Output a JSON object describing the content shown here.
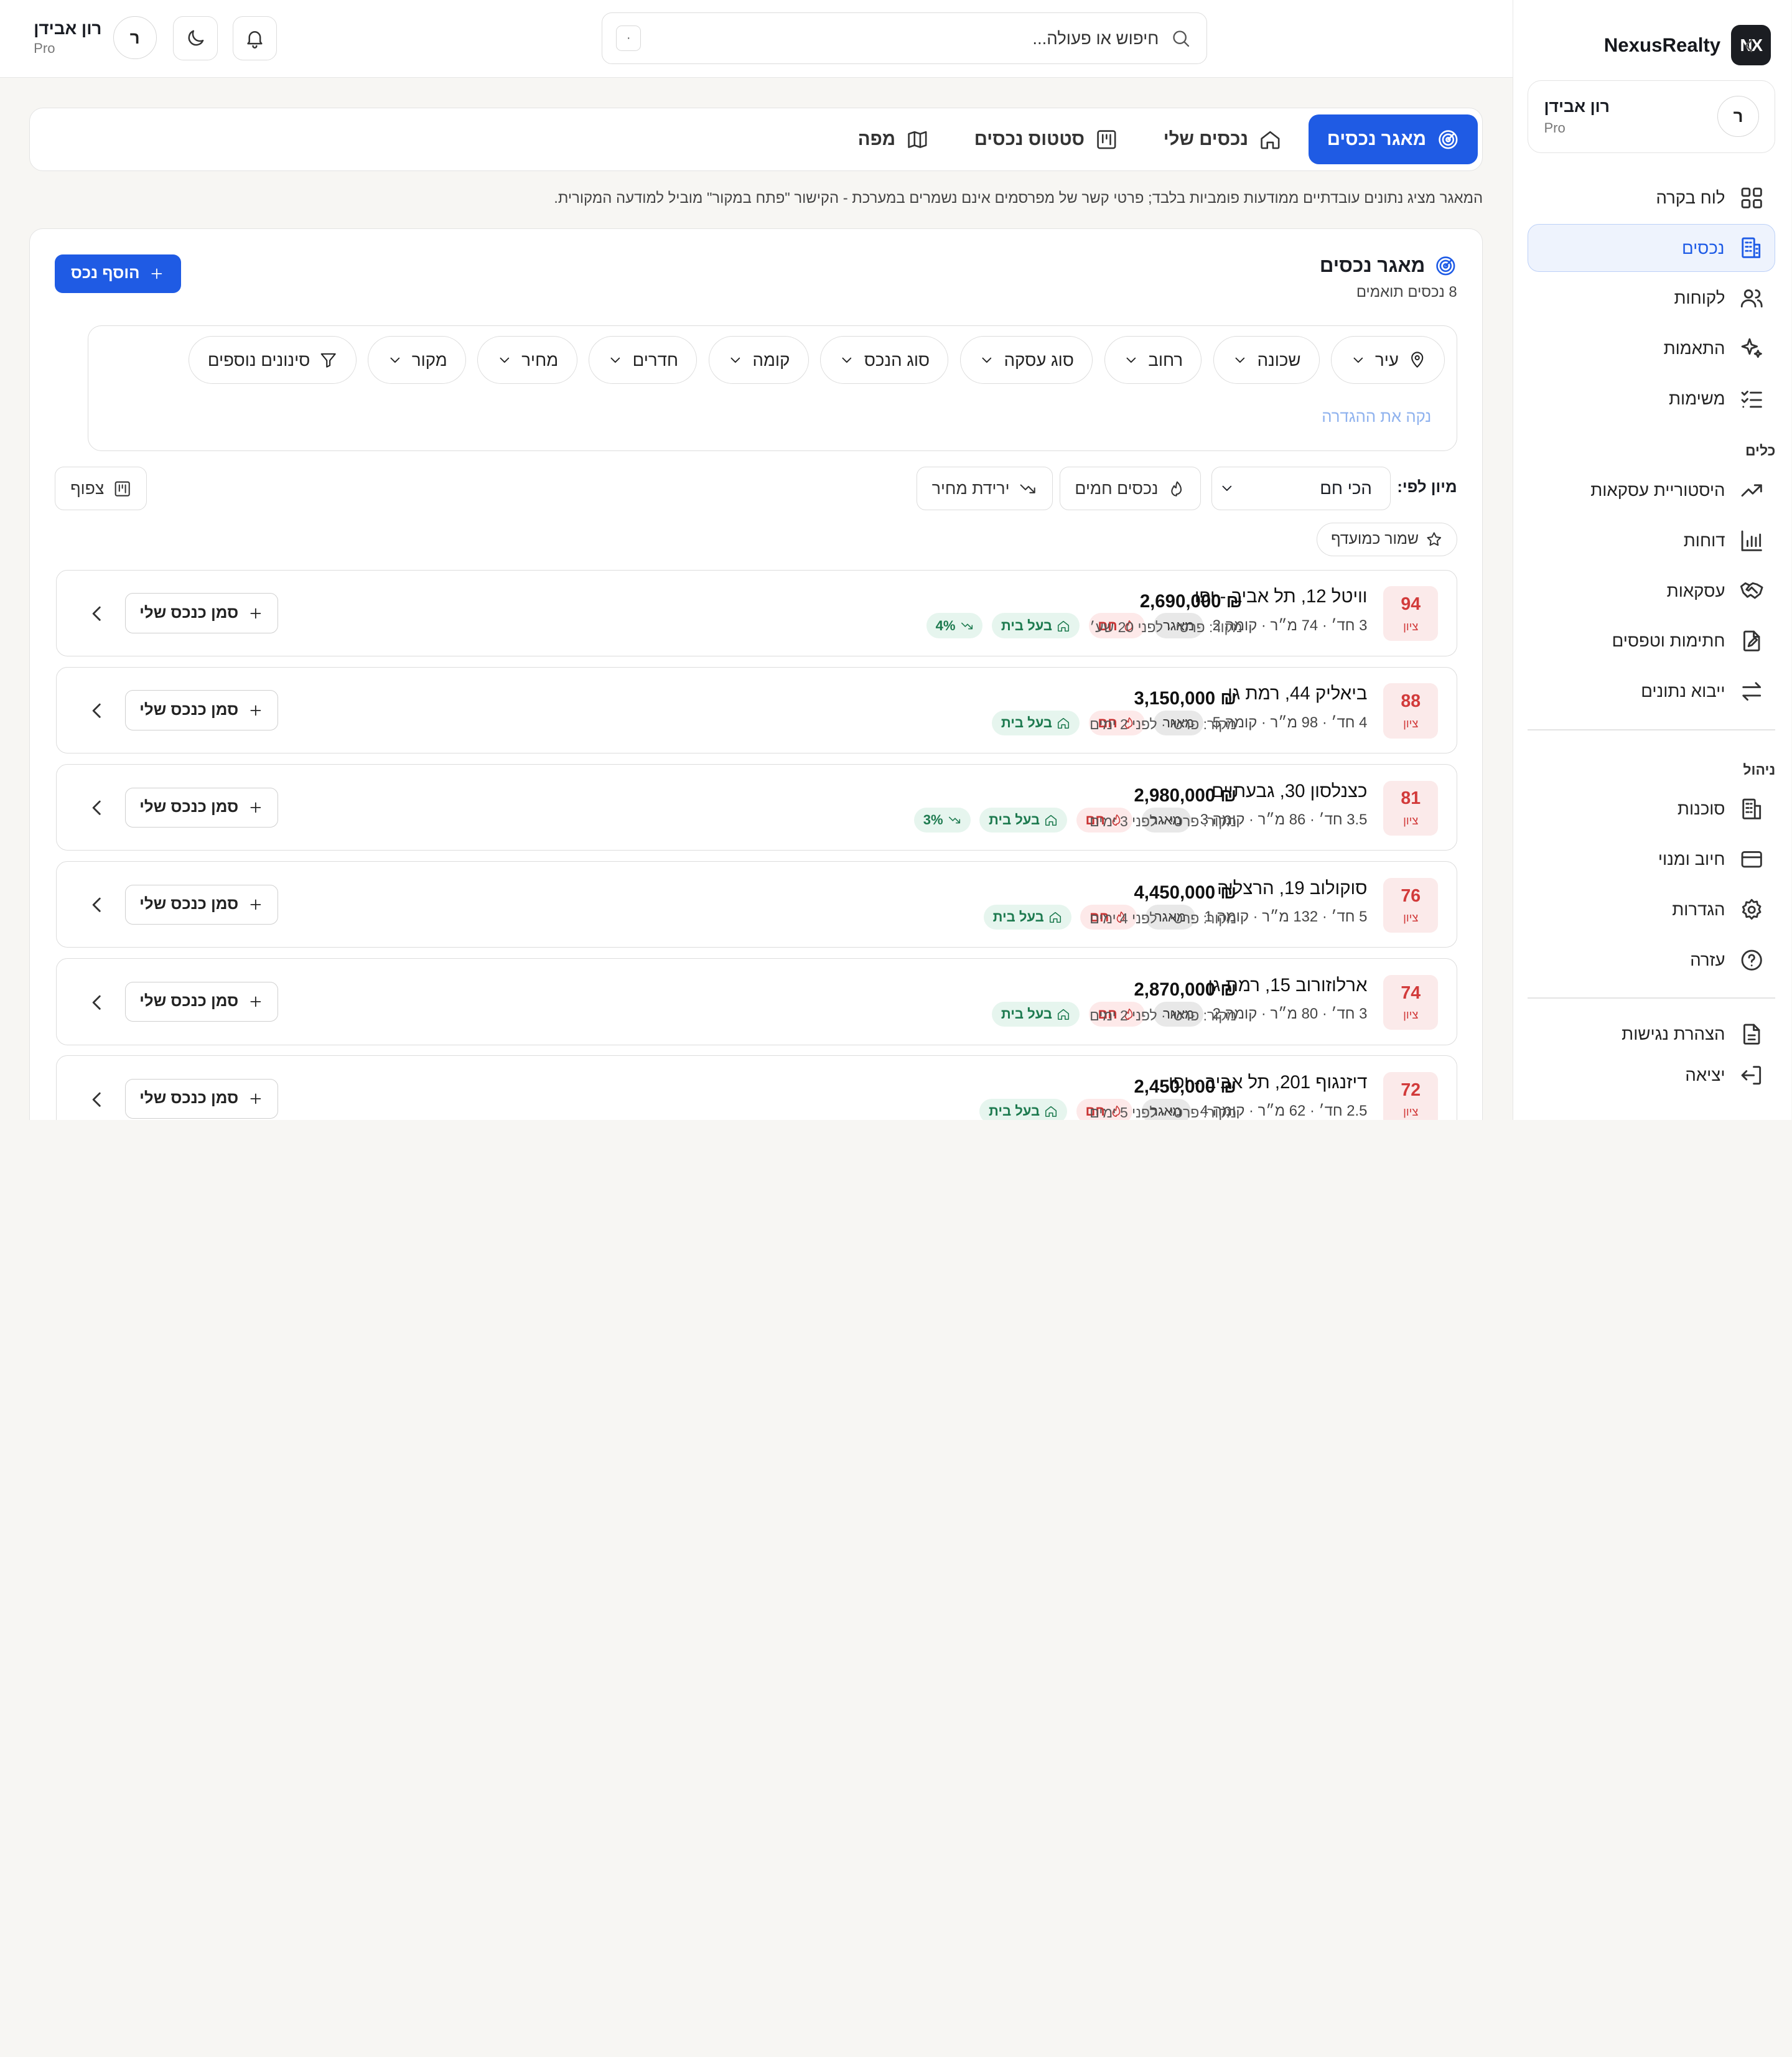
{
  "brand": {
    "logo": "NX",
    "name": "NexusRealty"
  },
  "user": {
    "initial": "ר",
    "name": "רון אבידן",
    "plan": "Pro"
  },
  "sidebar": {
    "main": [
      {
        "label": "לוח בקרה",
        "icon": "grid-icon"
      },
      {
        "label": "נכסים",
        "icon": "building-icon",
        "active": true
      },
      {
        "label": "לקוחות",
        "icon": "users-icon"
      },
      {
        "label": "התאמות",
        "icon": "sparkles-icon"
      },
      {
        "label": "משימות",
        "icon": "checklist-icon"
      }
    ],
    "tools_title": "כלים",
    "tools": [
      {
        "label": "היסטוריית עסקאות",
        "icon": "trend-up-icon"
      },
      {
        "label": "דוחות",
        "icon": "bar-chart-icon"
      },
      {
        "label": "עסקאות",
        "icon": "handshake-icon"
      },
      {
        "label": "חתימות וטפסים",
        "icon": "file-pen-icon"
      },
      {
        "label": "ייבוא נתונים",
        "icon": "arrows-swap-icon"
      }
    ],
    "admin_title": "ניהול",
    "admin": [
      {
        "label": "סוכנות",
        "icon": "office-icon"
      },
      {
        "label": "חיוב ומנוי",
        "icon": "credit-card-icon"
      },
      {
        "label": "הגדרות",
        "icon": "gear-icon"
      },
      {
        "label": "עזרה",
        "icon": "help-icon"
      }
    ],
    "footer": [
      {
        "label": "הצהרת נגישות",
        "icon": "document-icon"
      },
      {
        "label": "יציאה",
        "icon": "logout-icon"
      }
    ]
  },
  "header": {
    "search_placeholder": "חיפוש או פעולה...",
    "shortcut": "·"
  },
  "tabs": [
    {
      "label": "מאגר נכסים",
      "icon": "radar-icon",
      "active": true
    },
    {
      "label": "נכסים שלי",
      "icon": "home-icon"
    },
    {
      "label": "סטטוס נכסים",
      "icon": "kanban-icon"
    },
    {
      "label": "מפה",
      "icon": "map-icon"
    }
  ],
  "disclaimer": "המאגר מציג נתונים עובדתיים ממודעות פומביות בלבד; פרטי קשר של מפרסמים אינם נשמרים במערכת - הקישור \"פתח במקור\" מוביל למודעה המקורית.",
  "panel": {
    "title": "מאגר נכסים",
    "count": "8 נכסים תואמים",
    "add_button": "הוסף נכס",
    "filters": [
      "עיר",
      "שכונה",
      "רחוב",
      "סוג עסקה",
      "סוג הנכס",
      "קומה",
      "חדרים",
      "מחיר",
      "מקור"
    ],
    "more_filters": "סינונים נוספים",
    "clear": "נקה את ההגדרה",
    "sort_label": "מיון לפי:",
    "sort_value": "הכי חם",
    "hot_button": "נכסים חמים",
    "drop_button": "ירידת מחיר",
    "density_button": "צפוף",
    "save_fav": "שמור כמועדף"
  },
  "row_labels": {
    "score": "ציון",
    "pool": "מאגר",
    "hot": "חם",
    "owner": "בעל בית",
    "mark": "סמן כנכס שלי"
  },
  "listings": [
    {
      "score": "94",
      "address": "וויטל 12, תל אביב - יפו",
      "specs": "3 חד׳ · 74 מ״ר · קומה 2",
      "drop": "4%",
      "price": "₪ 2,690,000",
      "source": "מקור: פרטי · לפני 20 שע׳"
    },
    {
      "score": "88",
      "address": "ביאליק 44, רמת גן",
      "specs": "4 חד׳ · 98 מ״ר · קומה 5",
      "drop": "",
      "price": "₪ 3,150,000",
      "source": "מקור: פרטי · לפני 2 ימים"
    },
    {
      "score": "81",
      "address": "כצנלסון 30, גבעתיים",
      "specs": "3.5 חד׳ · 86 מ״ר · קומה 3",
      "drop": "3%",
      "price": "₪ 2,980,000",
      "source": "מקור: פרטי · לפני 3 ימים"
    },
    {
      "score": "76",
      "address": "סוקולוב 19, הרצליה",
      "specs": "5 חד׳ · 132 מ״ר · קומה 1",
      "drop": "",
      "price": "₪ 4,450,000",
      "source": "מקור: פרטי · לפני 4 ימים"
    },
    {
      "score": "74",
      "address": "ארלוזורוב 15, רמת גן",
      "specs": "3 חד׳ · 80 מ״ר · קומה 2",
      "drop": "",
      "price": "₪ 2,870,000",
      "source": "מקור: פרטי · לפני 2 ימים"
    },
    {
      "score": "72",
      "address": "דיזנגוף 201, תל אביב - יפו",
      "specs": "2.5 חד׳ · 62 מ״ר · קומה 4",
      "drop": "",
      "price": "₪ 2,450,000",
      "source": "מקור: פרטי · לפני 5 ימים"
    }
  ]
}
